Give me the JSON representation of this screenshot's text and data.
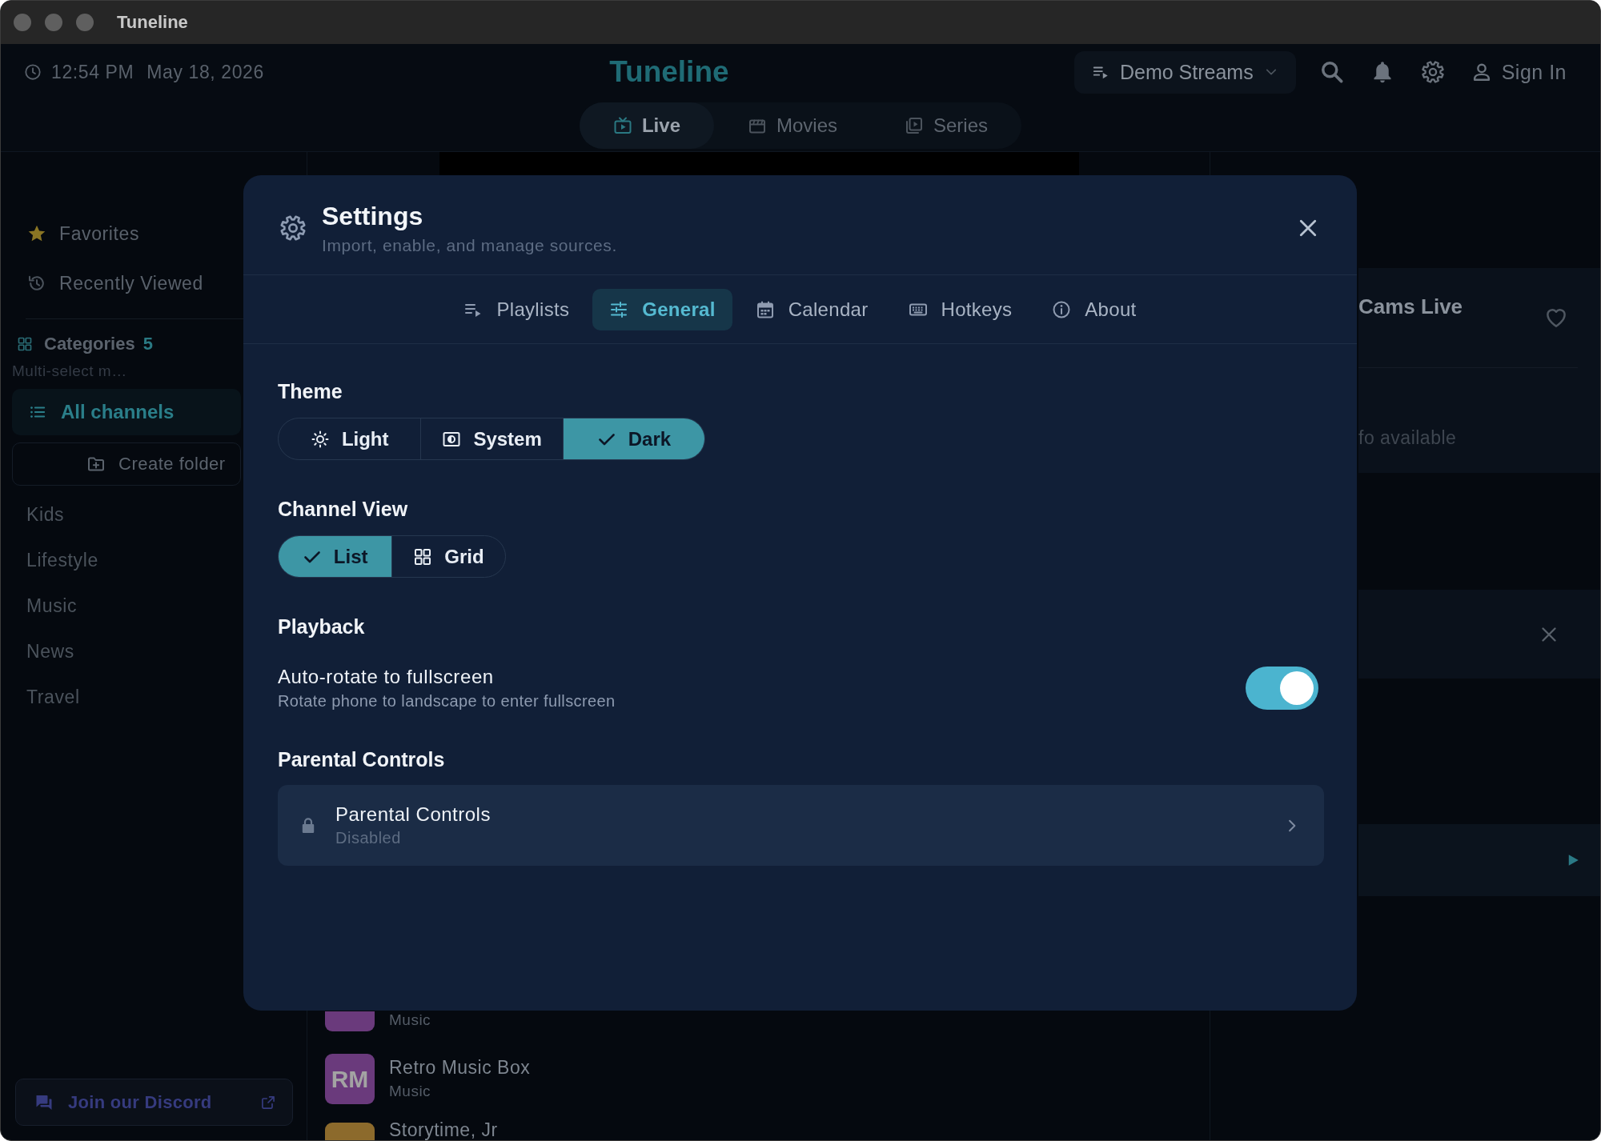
{
  "window": {
    "title": "Tuneline"
  },
  "header": {
    "time": "12:54 PM",
    "date": "May 18, 2026",
    "brand": "Tuneline",
    "playlist": "Demo Streams",
    "sign_in": "Sign In"
  },
  "nav_tabs": [
    {
      "label": "Live",
      "selected": true
    },
    {
      "label": "Movies",
      "selected": false
    },
    {
      "label": "Series",
      "selected": false
    }
  ],
  "sidebar": {
    "shortcuts": [
      {
        "label": "Favorites",
        "kind": "favorites"
      },
      {
        "label": "Recently Viewed",
        "kind": "recent"
      }
    ],
    "categories_title": "Categories",
    "categories_count": "5",
    "hint": "Multi-select m…",
    "groups": [
      {
        "label": "All channels",
        "selected": true
      }
    ],
    "create_folder": "Create folder",
    "categories": [
      {
        "label": "Kids",
        "selected": false
      },
      {
        "label": "Lifestyle",
        "selected": false
      },
      {
        "label": "Music",
        "selected": false
      },
      {
        "label": "News",
        "selected": false
      },
      {
        "label": "Travel",
        "selected": false
      }
    ],
    "discord": "Join our Discord"
  },
  "channels": [
    {
      "kind": "cut_top",
      "category": "Music",
      "color": "#6a3a7c"
    },
    {
      "kind": "full",
      "initials": "RM",
      "name": "Retro Music Box",
      "category": "Music",
      "color": "#6a3a7c"
    },
    {
      "kind": "cut_bottom",
      "name": "Storytime, Jr",
      "color": "#8c6a2c"
    }
  ],
  "channel_panel": {
    "title": "Cams Live",
    "description": "fo available"
  },
  "settings": {
    "title": "Settings",
    "subtitle": "Import, enable, and manage sources.",
    "tabs": [
      {
        "label": "Playlists",
        "selected": false
      },
      {
        "label": "General",
        "selected": true
      },
      {
        "label": "Calendar",
        "selected": false
      },
      {
        "label": "Hotkeys",
        "selected": false
      },
      {
        "label": "About",
        "selected": false
      }
    ],
    "sections": [
      {
        "kind": "segmented",
        "heading": "Theme",
        "options": [
          {
            "label": "Light",
            "selected": false
          },
          {
            "label": "System",
            "selected": false
          },
          {
            "label": "Dark",
            "selected": true
          }
        ]
      },
      {
        "kind": "segmented",
        "heading": "Channel View",
        "options": [
          {
            "label": "List",
            "selected": true
          },
          {
            "label": "Grid",
            "selected": false
          }
        ]
      },
      {
        "kind": "toggle",
        "heading": "Playback",
        "label": "Auto-rotate to fullscreen",
        "description": "Rotate phone to landscape to enter fullscreen",
        "on": true
      },
      {
        "kind": "link",
        "heading": "Parental Controls",
        "label": "Parental Controls",
        "status": "Disabled"
      }
    ]
  }
}
